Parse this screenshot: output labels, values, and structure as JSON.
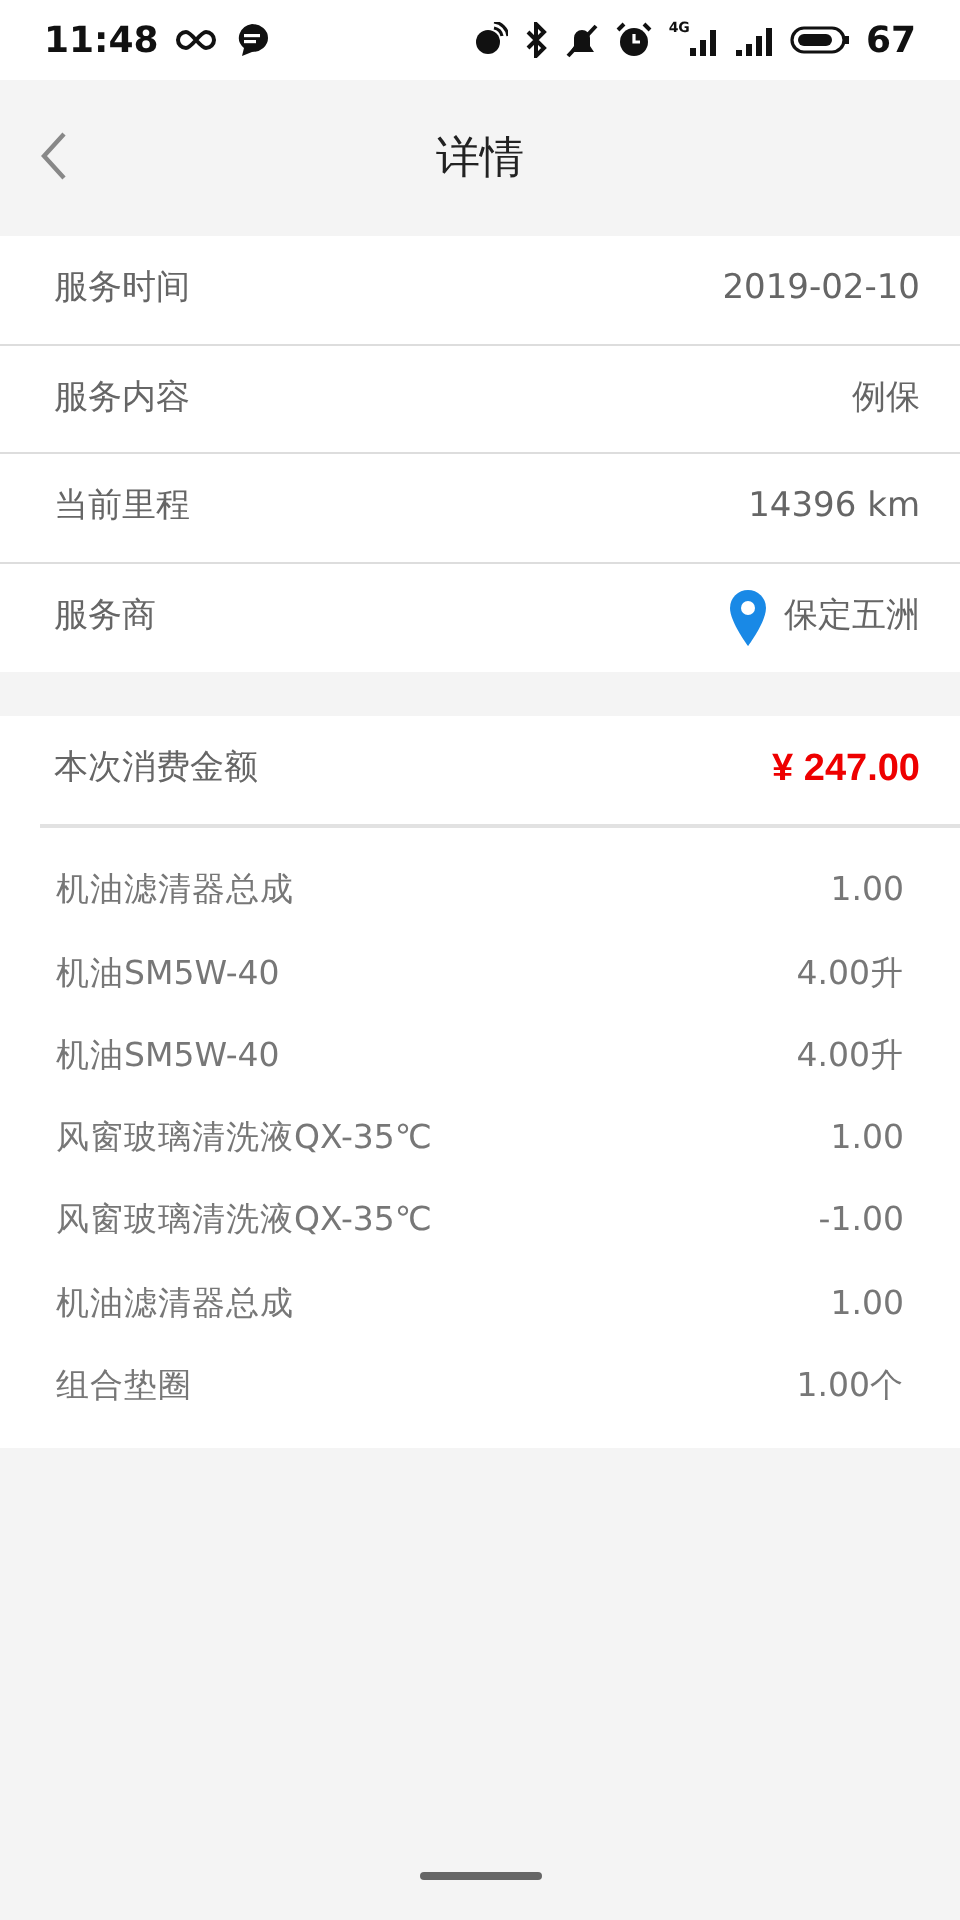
{
  "status_bar": {
    "time": "11:48",
    "network": "4G",
    "battery": "67"
  },
  "header": {
    "title": "详情"
  },
  "info_rows": [
    {
      "label": "服务时间",
      "value": "2019-02-10",
      "kind": "text"
    },
    {
      "label": "服务内容",
      "value": "例保",
      "kind": "text"
    },
    {
      "label": "当前里程",
      "value": "14396 km",
      "kind": "text"
    },
    {
      "label": "服务商",
      "value": "保定五洲",
      "kind": "location"
    }
  ],
  "total": {
    "label": "本次消费金额",
    "amount": "¥ 247.00"
  },
  "items": [
    {
      "name": "机油滤清器总成",
      "quantity": "1.00"
    },
    {
      "name": "机油SM5W-40",
      "quantity": "4.00升"
    },
    {
      "name": "机油SM5W-40",
      "quantity": "4.00升"
    },
    {
      "name": "风窗玻璃清洗液QX-35℃",
      "quantity": "1.00"
    },
    {
      "name": "风窗玻璃清洗液QX-35℃",
      "quantity": "-1.00"
    },
    {
      "name": "机油滤清器总成",
      "quantity": "1.00"
    },
    {
      "name": "组合垫圈",
      "quantity": "1.00个"
    }
  ]
}
